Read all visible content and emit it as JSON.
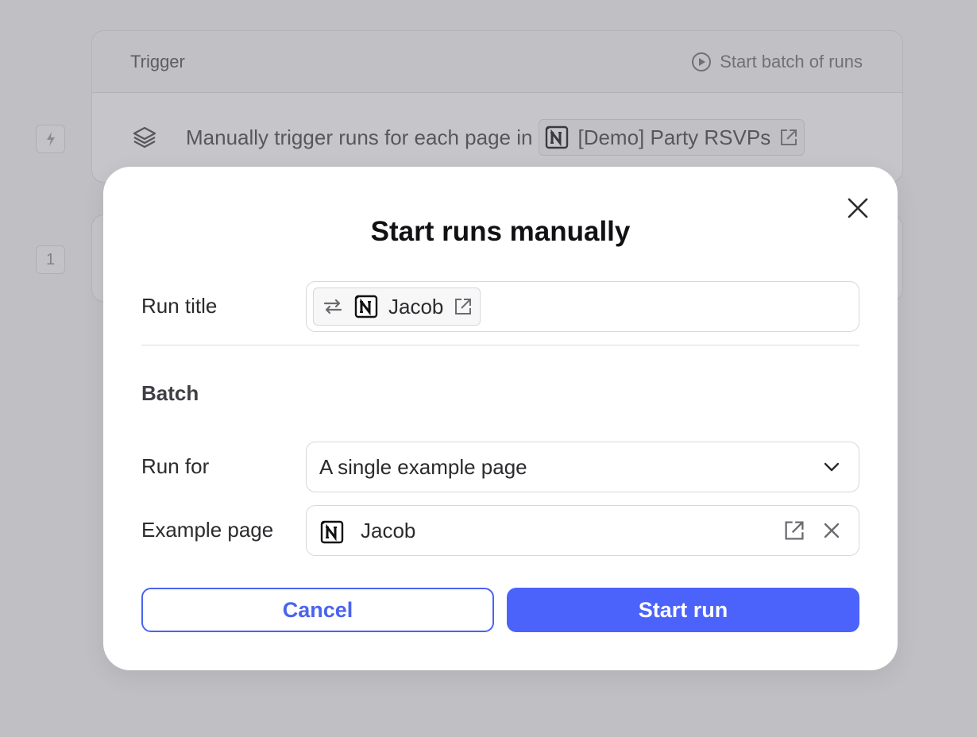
{
  "background": {
    "steps": [
      {
        "number": ""
      },
      {
        "number": "1"
      }
    ],
    "trigger_card": {
      "title": "Trigger",
      "action_label": "Start batch of runs",
      "description": "Manually trigger runs for each page in",
      "source_name": "[Demo] Party RSVPs"
    }
  },
  "modal": {
    "title": "Start runs manually",
    "run_title": {
      "label": "Run title",
      "token_value": "Jacob"
    },
    "batch": {
      "section_title": "Batch",
      "run_for": {
        "label": "Run for",
        "selected": "A single example page"
      },
      "example_page": {
        "label": "Example page",
        "value": "Jacob"
      }
    },
    "buttons": {
      "cancel": "Cancel",
      "start": "Start run"
    }
  },
  "colors": {
    "primary": "#4b63fb",
    "overlay": "rgba(120,120,128,0.42)"
  }
}
